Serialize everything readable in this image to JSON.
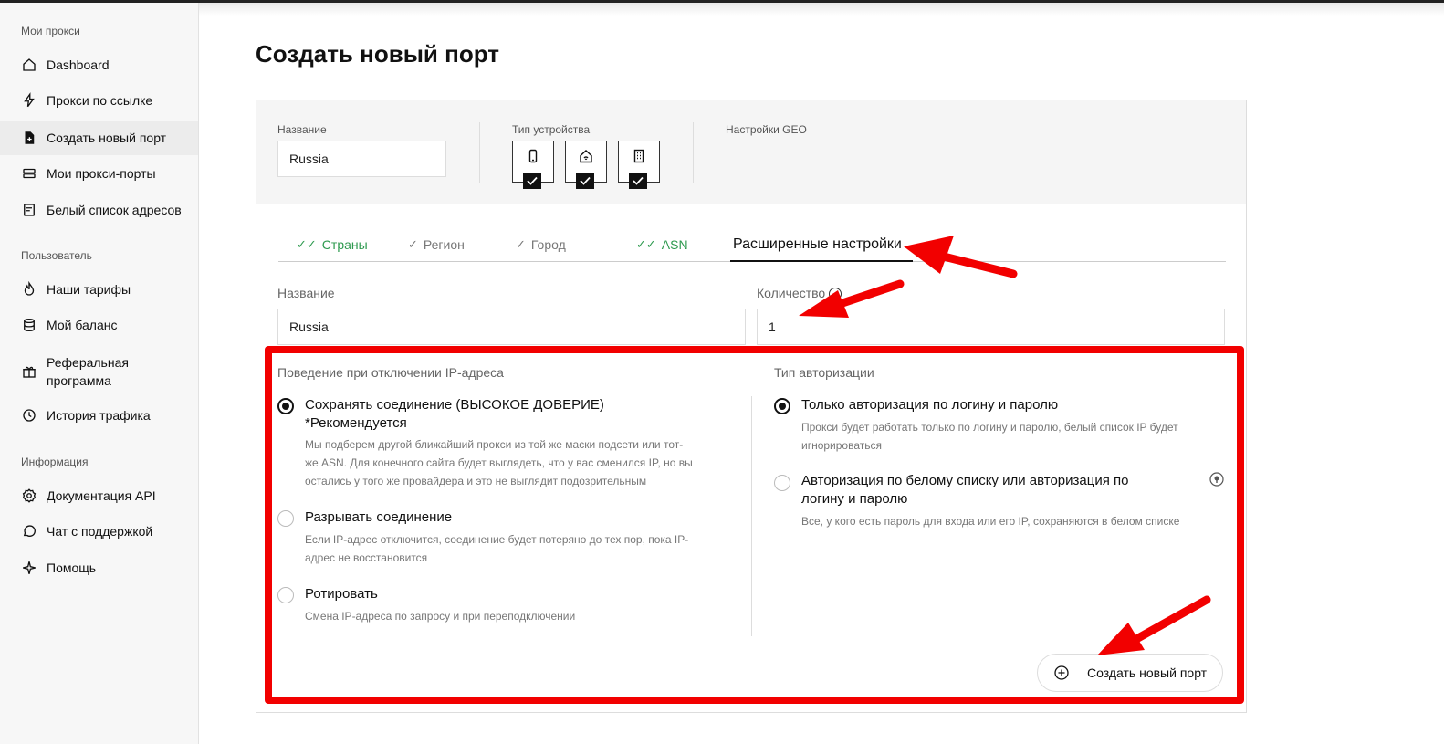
{
  "sidebar": {
    "sections": [
      {
        "title": "Мои прокси"
      },
      {
        "title": "Пользователь"
      },
      {
        "title": "Информация"
      }
    ],
    "items": [
      {
        "label": "Dashboard",
        "icon": "home-icon"
      },
      {
        "label": "Прокси по ссылке",
        "icon": "lightning-icon"
      },
      {
        "label": "Создать новый порт",
        "icon": "file-plus-icon"
      },
      {
        "label": "Мои прокси-порты",
        "icon": "server-icon"
      },
      {
        "label": "Белый список адресов",
        "icon": "list-icon"
      },
      {
        "label": "Наши тарифы",
        "icon": "flame-icon"
      },
      {
        "label": "Мой баланс",
        "icon": "coins-icon"
      },
      {
        "label": "Реферальная программа",
        "icon": "gift-icon"
      },
      {
        "label": "История трафика",
        "icon": "clock-icon"
      },
      {
        "label": "Документация API",
        "icon": "gear-icon"
      },
      {
        "label": "Чат с поддержкой",
        "icon": "chat-icon"
      },
      {
        "label": "Помощь",
        "icon": "sparkle-icon"
      }
    ]
  },
  "page": {
    "title": "Создать новый порт"
  },
  "top": {
    "name_label": "Название",
    "name_value": "Russia",
    "device_label": "Тип устройства",
    "geo_label": "Настройки GEO"
  },
  "tabs": [
    {
      "label": "Страны"
    },
    {
      "label": "Регион"
    },
    {
      "label": "Город"
    },
    {
      "label": "ASN"
    },
    {
      "label": "Расширенные настройки"
    }
  ],
  "fields": {
    "name_label": "Название",
    "name_value": "Russia",
    "count_label": "Количество",
    "count_value": "1"
  },
  "behavior": {
    "heading": "Поведение при отключении IP-адреса",
    "options": [
      {
        "title_line1": "Сохранять соединение (ВЫСОКОЕ ДОВЕРИЕ)",
        "title_line2": "*Рекомендуется",
        "desc_line1": "Мы подберем другой ближайший прокси из той же маски подсети или тот-",
        "desc_line2": "же ASN. Для конечного сайта будет выглядеть, что у вас сменился IP, но вы",
        "desc_line3": "остались у того же провайдера и это не выглядит подозрительным"
      },
      {
        "title_line1": "Разрывать соединение",
        "desc_line1": "Если IP-адрес отключится, соединение будет потеряно до тех пор, пока IP-",
        "desc_line2": "адрес не восстановится"
      },
      {
        "title_line1": "Ротировать",
        "desc_line1": "Смена IP-адреса по запросу и при переподключении"
      }
    ]
  },
  "auth": {
    "heading": "Тип авторизации",
    "options": [
      {
        "title_line1": "Только авторизация по логину и паролю",
        "desc_line1": "Прокси будет работать только по логину и паролю, белый список IP будет",
        "desc_line2": "игнорироваться"
      },
      {
        "title_line1": "Авторизация по белому списку или авторизация по",
        "title_line2": "логину и паролю",
        "desc_line1": "Все, у кого есть пароль для входа или его IP, сохраняются в белом списке"
      }
    ]
  },
  "actions": {
    "create_label": "Создать новый порт"
  },
  "colors": {
    "annotation_red": "#f20000",
    "tab_green": "#2e9a4f"
  }
}
